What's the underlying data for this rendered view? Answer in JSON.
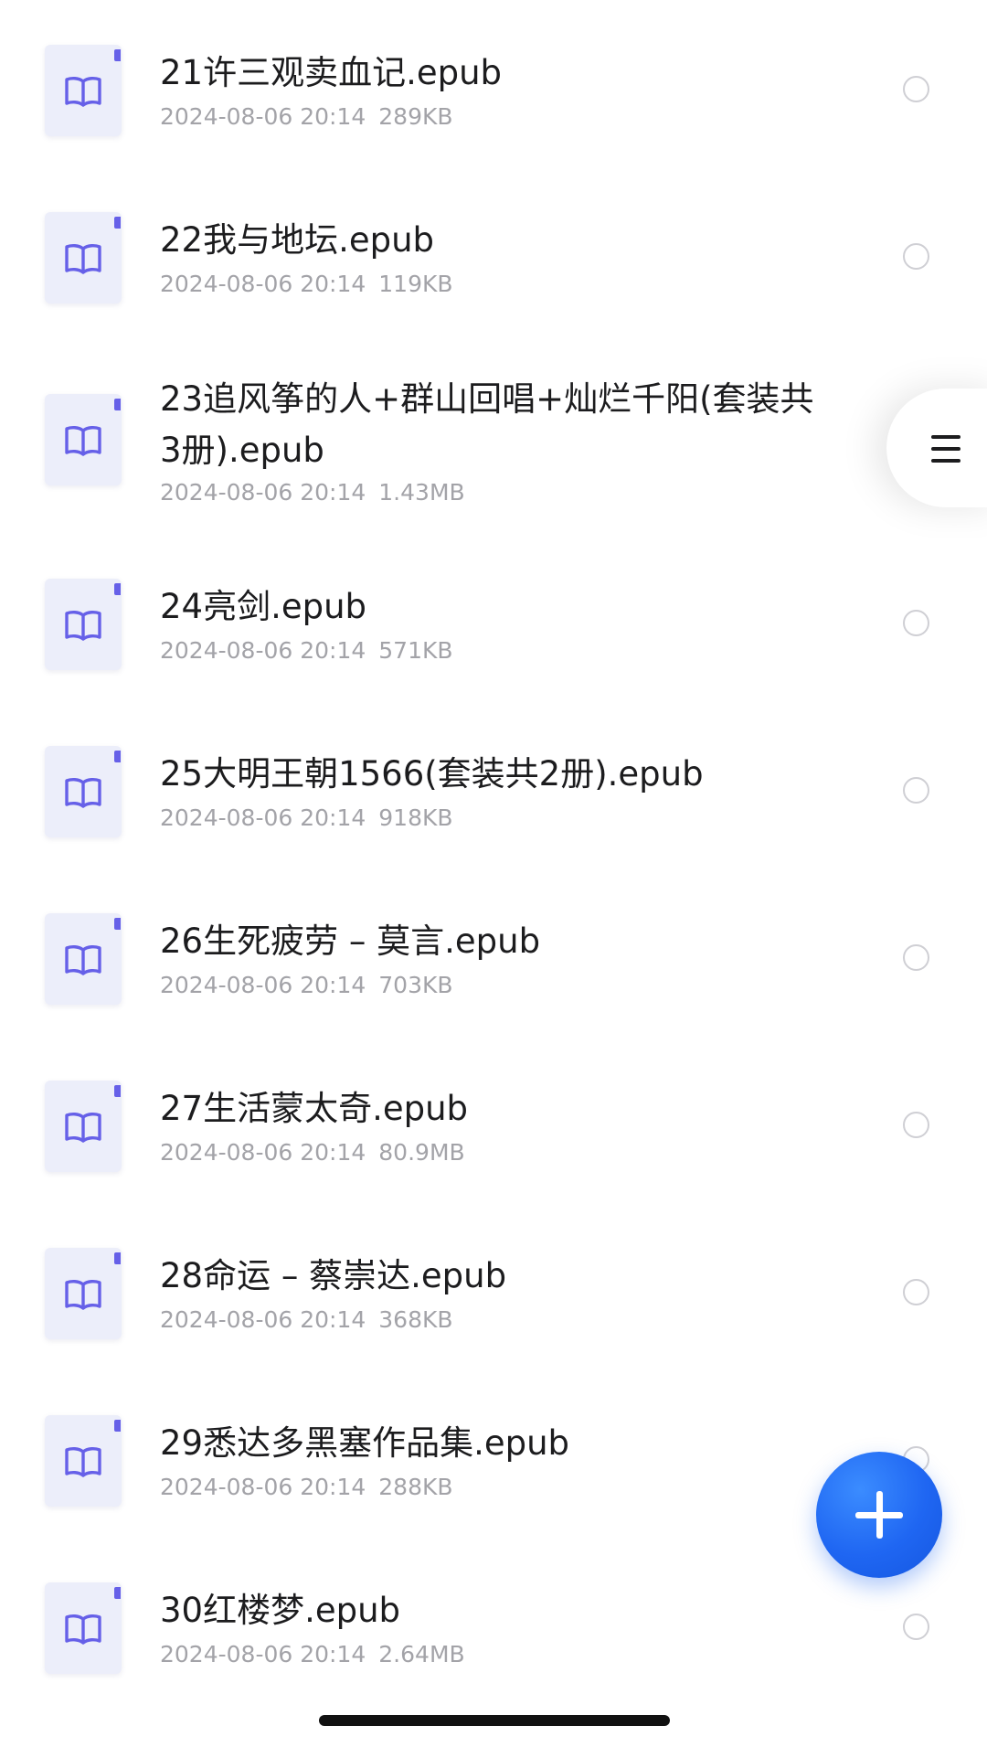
{
  "files": [
    {
      "name": "21许三观卖血记.epub",
      "date": "2024-08-06 20:14",
      "size": "289KB"
    },
    {
      "name": "22我与地坛.epub",
      "date": "2024-08-06 20:14",
      "size": "119KB"
    },
    {
      "name": "23追风筝的人+群山回唱+灿烂千阳(套装共3册).epub",
      "date": "2024-08-06 20:14",
      "size": "1.43MB"
    },
    {
      "name": "24亮剑.epub",
      "date": "2024-08-06 20:14",
      "size": "571KB"
    },
    {
      "name": "25大明王朝1566(套装共2册).epub",
      "date": "2024-08-06 20:14",
      "size": "918KB"
    },
    {
      "name": "26生死疲劳 – 莫言.epub",
      "date": "2024-08-06 20:14",
      "size": "703KB"
    },
    {
      "name": "27生活蒙太奇.epub",
      "date": "2024-08-06 20:14",
      "size": "80.9MB"
    },
    {
      "name": "28命运 – 蔡崇达.epub",
      "date": "2024-08-06 20:14",
      "size": "368KB"
    },
    {
      "name": "29悉达多黑塞作品集.epub",
      "date": "2024-08-06 20:14",
      "size": "288KB"
    },
    {
      "name": "30红楼梦.epub",
      "date": "2024-08-06 20:14",
      "size": "2.64MB"
    }
  ],
  "icons": {
    "file": "book-icon",
    "select": "radio-circle-icon",
    "menu": "menu-icon",
    "add": "plus-icon"
  },
  "colors": {
    "accent": "#1f66f2",
    "file_icon_bg": "#eceefa",
    "book_icon": "#6660e8",
    "title_text": "#1c1c1e",
    "meta_text": "#a3a3a8"
  }
}
